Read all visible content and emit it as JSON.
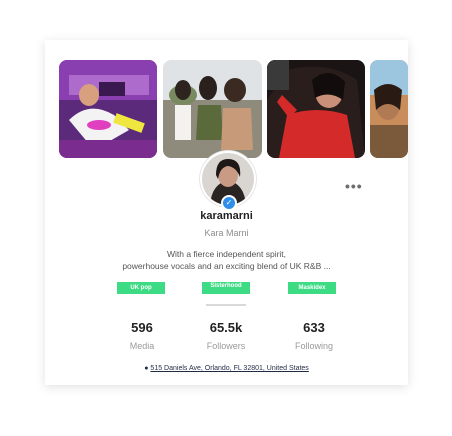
{
  "profile": {
    "username": "karamarni",
    "full_name": "Kara Marni",
    "bio_line1": "With a fierce independent spirit,",
    "bio_line2": "powerhouse vocals and an exciting blend of UK R&B ...",
    "verified": true
  },
  "tags": [
    "UK pop",
    "Sisterhood",
    "Maskidex"
  ],
  "stats": {
    "media": {
      "value": "596",
      "label": "Media"
    },
    "followers": {
      "value": "65.5k",
      "label": "Followers"
    },
    "following": {
      "value": "633",
      "label": "Following"
    }
  },
  "location": {
    "icon": "map-pin-icon",
    "address": "515 Daniels Ave, Orlando, FL 32801, United States"
  },
  "more_icon": "more-dots-icon",
  "colors": {
    "tag_bg": "#3ddc84",
    "verified": "#2f8fe8",
    "link": "#1f2a44"
  }
}
